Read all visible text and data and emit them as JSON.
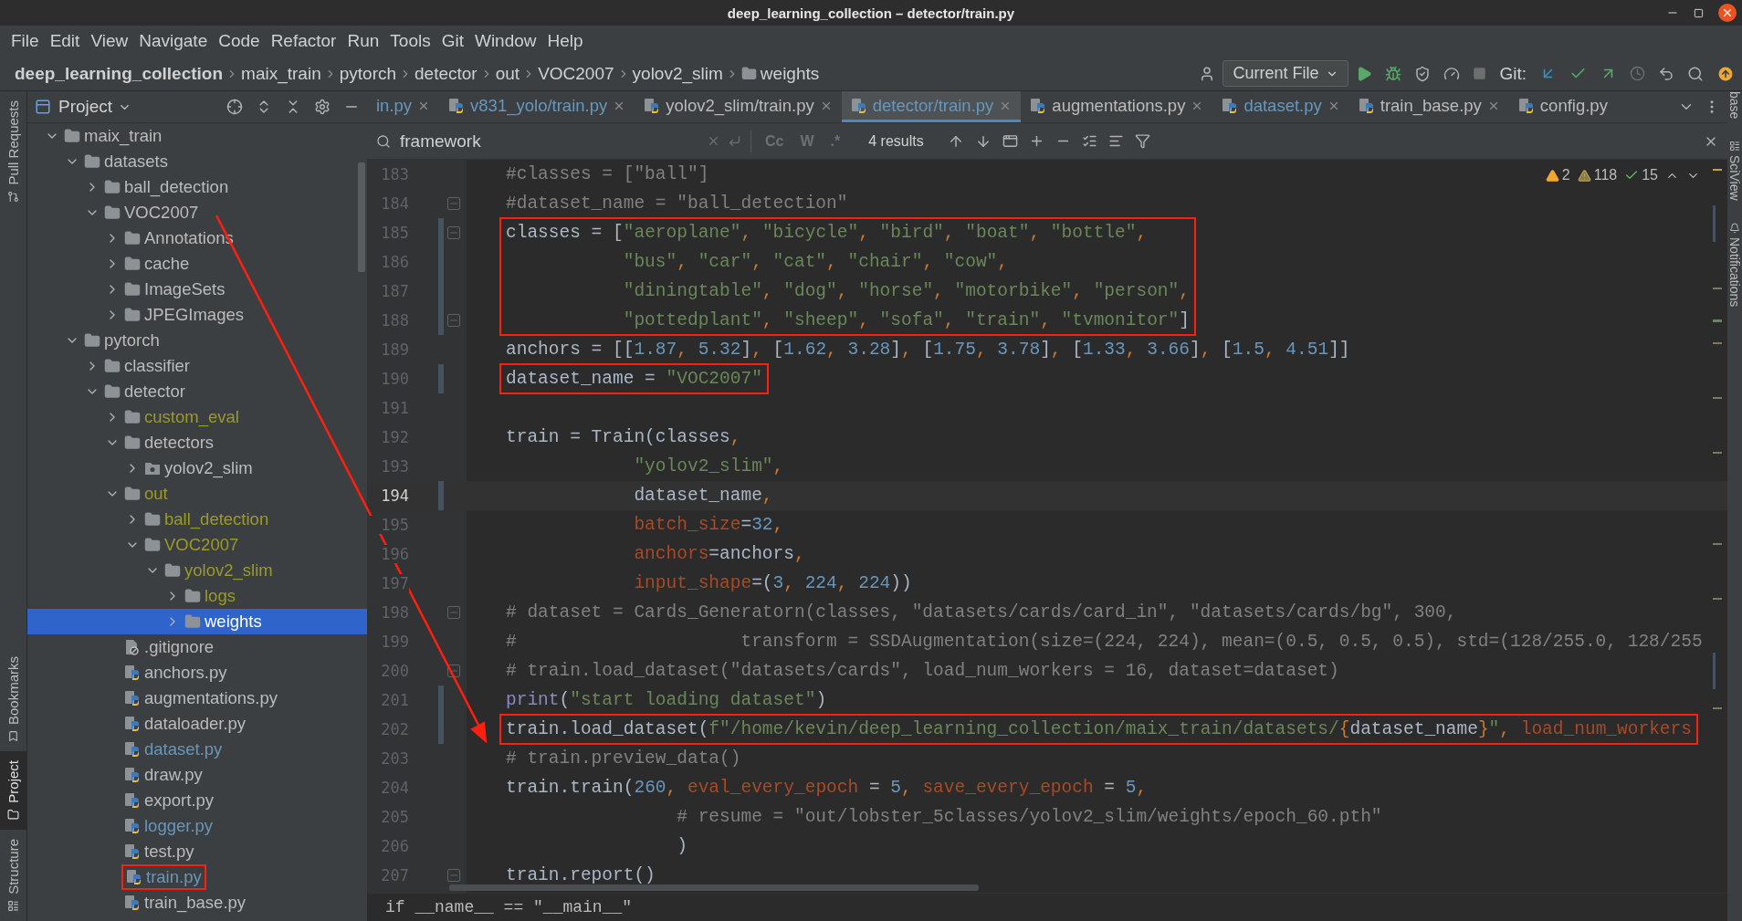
{
  "window": {
    "title": "deep_learning_collection – detector/train.py"
  },
  "menu": [
    "File",
    "Edit",
    "View",
    "Navigate",
    "Code",
    "Refactor",
    "Run",
    "Tools",
    "Git",
    "Window",
    "Help"
  ],
  "breadcrumb": [
    "deep_learning_collection",
    "maix_train",
    "pytorch",
    "detector",
    "out",
    "VOC2007",
    "yolov2_slim",
    "weights"
  ],
  "run_config": {
    "label": "Current File"
  },
  "git_label": "Git:",
  "left_strip": [
    {
      "label": "Pull Requests",
      "selected": false
    },
    {
      "label": "Bookmarks",
      "selected": false
    },
    {
      "label": "Project",
      "selected": true
    },
    {
      "label": "Structure",
      "selected": false
    }
  ],
  "right_strip": [
    {
      "label": "base"
    },
    {
      "label": "SciView"
    },
    {
      "label": "Notifications"
    }
  ],
  "project_panel": {
    "title": "Project",
    "tree": [
      {
        "name": "maix_train",
        "kind": "folder",
        "ignored": false,
        "selected": false,
        "boxed": false,
        "expanded": true,
        "children": [
          {
            "name": "datasets",
            "kind": "folder",
            "ignored": false,
            "selected": false,
            "boxed": false,
            "expanded": true,
            "children": [
              {
                "name": "ball_detection",
                "kind": "folder",
                "ignored": false,
                "selected": false,
                "boxed": false,
                "expanded": false
              },
              {
                "name": "VOC2007",
                "kind": "folder",
                "ignored": false,
                "selected": false,
                "boxed": false,
                "expanded": true,
                "children": [
                  {
                    "name": "Annotations",
                    "kind": "folder",
                    "ignored": false,
                    "selected": false,
                    "boxed": false,
                    "expanded": false
                  },
                  {
                    "name": "cache",
                    "kind": "folder",
                    "ignored": false,
                    "selected": false,
                    "boxed": false,
                    "expanded": false
                  },
                  {
                    "name": "ImageSets",
                    "kind": "folder",
                    "ignored": false,
                    "selected": false,
                    "boxed": false,
                    "expanded": false
                  },
                  {
                    "name": "JPEGImages",
                    "kind": "folder",
                    "ignored": false,
                    "selected": false,
                    "boxed": false,
                    "expanded": false
                  }
                ]
              }
            ]
          },
          {
            "name": "pytorch",
            "kind": "folder",
            "ignored": false,
            "selected": false,
            "boxed": false,
            "expanded": true,
            "children": [
              {
                "name": "classifier",
                "kind": "folder",
                "ignored": false,
                "selected": false,
                "boxed": false,
                "expanded": false
              },
              {
                "name": "detector",
                "kind": "folder",
                "ignored": false,
                "selected": false,
                "boxed": false,
                "expanded": true,
                "children": [
                  {
                    "name": "custom_eval",
                    "kind": "folder",
                    "ignored": true,
                    "selected": false,
                    "boxed": false,
                    "expanded": false
                  },
                  {
                    "name": "detectors",
                    "kind": "folder",
                    "ignored": false,
                    "selected": false,
                    "boxed": false,
                    "expanded": true,
                    "children": [
                      {
                        "name": "yolov2_slim",
                        "kind": "package",
                        "ignored": false,
                        "selected": false,
                        "boxed": false,
                        "expanded": false
                      }
                    ]
                  },
                  {
                    "name": "out",
                    "kind": "folder",
                    "ignored": true,
                    "selected": false,
                    "boxed": false,
                    "expanded": true,
                    "children": [
                      {
                        "name": "ball_detection",
                        "kind": "folder",
                        "ignored": true,
                        "selected": false,
                        "boxed": false,
                        "expanded": false
                      },
                      {
                        "name": "VOC2007",
                        "kind": "folder",
                        "ignored": true,
                        "selected": false,
                        "boxed": false,
                        "expanded": true,
                        "children": [
                          {
                            "name": "yolov2_slim",
                            "kind": "folder",
                            "ignored": true,
                            "selected": false,
                            "boxed": false,
                            "expanded": true,
                            "children": [
                              {
                                "name": "logs",
                                "kind": "folder",
                                "ignored": true,
                                "selected": false,
                                "boxed": false,
                                "expanded": false
                              },
                              {
                                "name": "weights",
                                "kind": "folder",
                                "ignored": true,
                                "selected": true,
                                "boxed": false,
                                "expanded": false
                              }
                            ]
                          }
                        ]
                      }
                    ]
                  },
                  {
                    "name": ".gitignore",
                    "kind": "gitignore",
                    "modified": false,
                    "selected": false,
                    "boxed": false
                  },
                  {
                    "name": "anchors.py",
                    "kind": "python",
                    "modified": false,
                    "selected": false,
                    "boxed": false
                  },
                  {
                    "name": "augmentations.py",
                    "kind": "python",
                    "modified": false,
                    "selected": false,
                    "boxed": false
                  },
                  {
                    "name": "dataloader.py",
                    "kind": "python",
                    "modified": false,
                    "selected": false,
                    "boxed": false
                  },
                  {
                    "name": "dataset.py",
                    "kind": "python",
                    "modified": true,
                    "selected": false,
                    "boxed": false
                  },
                  {
                    "name": "draw.py",
                    "kind": "python",
                    "modified": false,
                    "selected": false,
                    "boxed": false
                  },
                  {
                    "name": "export.py",
                    "kind": "python",
                    "modified": false,
                    "selected": false,
                    "boxed": false
                  },
                  {
                    "name": "logger.py",
                    "kind": "python",
                    "modified": true,
                    "selected": false,
                    "boxed": false
                  },
                  {
                    "name": "test.py",
                    "kind": "python",
                    "modified": false,
                    "selected": false,
                    "boxed": false
                  },
                  {
                    "name": "train.py",
                    "kind": "python",
                    "modified": true,
                    "selected": false,
                    "boxed": true
                  },
                  {
                    "name": "train_base.py",
                    "kind": "python",
                    "modified": false,
                    "selected": false,
                    "boxed": false
                  }
                ]
              }
            ]
          }
        ]
      }
    ]
  },
  "tabs": [
    {
      "label": "in.py",
      "selected": false,
      "modified": true,
      "icon": false,
      "closable": true
    },
    {
      "label": "v831_yolo/train.py",
      "selected": false,
      "modified": true,
      "icon": true,
      "closable": true
    },
    {
      "label": "yolov2_slim/train.py",
      "selected": false,
      "modified": false,
      "icon": true,
      "closable": true
    },
    {
      "label": "detector/train.py",
      "selected": true,
      "modified": true,
      "icon": true,
      "closable": true
    },
    {
      "label": "augmentations.py",
      "selected": false,
      "modified": false,
      "icon": true,
      "closable": true
    },
    {
      "label": "dataset.py",
      "selected": false,
      "modified": true,
      "icon": true,
      "closable": true
    },
    {
      "label": "train_base.py",
      "selected": false,
      "modified": false,
      "icon": true,
      "closable": true
    },
    {
      "label": "config.py",
      "selected": false,
      "modified": false,
      "icon": true,
      "closable": false
    }
  ],
  "find_bar": {
    "value": "framework",
    "options": [
      "Cc",
      "W",
      ".*"
    ],
    "results": "4 results"
  },
  "inspections": [
    {
      "kind": "warning",
      "count": "2"
    },
    {
      "kind": "weak_warning",
      "count": "118"
    },
    {
      "kind": "typo",
      "count": "15"
    }
  ],
  "code": [
    {
      "number": "183",
      "changed": false,
      "fold": false,
      "current": false,
      "boxed": false,
      "tokens": [
        {
          "kind": "comment",
          "text": "#classes = [\"ball\"]"
        }
      ]
    },
    {
      "number": "184",
      "changed": false,
      "fold": true,
      "current": false,
      "boxed": false,
      "tokens": [
        {
          "kind": "comment",
          "text": "#dataset_name = \"ball_detection\""
        }
      ]
    },
    {
      "number": "185",
      "changed": true,
      "fold": true,
      "current": false,
      "boxed": true,
      "tokens": [
        {
          "kind": "plain",
          "text": "classes = ["
        },
        {
          "kind": "string",
          "text": "\"aeroplane\""
        },
        {
          "kind": "punct",
          "text": ", "
        },
        {
          "kind": "string",
          "text": "\"bicycle\""
        },
        {
          "kind": "punct",
          "text": ", "
        },
        {
          "kind": "string",
          "text": "\"bird\""
        },
        {
          "kind": "punct",
          "text": ", "
        },
        {
          "kind": "string",
          "text": "\"boat\""
        },
        {
          "kind": "punct",
          "text": ", "
        },
        {
          "kind": "string",
          "text": "\"bottle\""
        },
        {
          "kind": "punct",
          "text": ","
        }
      ]
    },
    {
      "number": "186",
      "changed": true,
      "fold": false,
      "current": false,
      "boxed": true,
      "tokens": [
        {
          "kind": "string",
          "text": "           \"bus\""
        },
        {
          "kind": "punct",
          "text": ", "
        },
        {
          "kind": "string",
          "text": "\"car\""
        },
        {
          "kind": "punct",
          "text": ", "
        },
        {
          "kind": "string",
          "text": "\"cat\""
        },
        {
          "kind": "punct",
          "text": ", "
        },
        {
          "kind": "string",
          "text": "\"chair\""
        },
        {
          "kind": "punct",
          "text": ", "
        },
        {
          "kind": "string",
          "text": "\"cow\""
        },
        {
          "kind": "punct",
          "text": ","
        }
      ]
    },
    {
      "number": "187",
      "changed": true,
      "fold": false,
      "current": false,
      "boxed": true,
      "tokens": [
        {
          "kind": "string",
          "text": "           \"diningtable\""
        },
        {
          "kind": "punct",
          "text": ", "
        },
        {
          "kind": "string",
          "text": "\"dog\""
        },
        {
          "kind": "punct",
          "text": ", "
        },
        {
          "kind": "string",
          "text": "\"horse\""
        },
        {
          "kind": "punct",
          "text": ", "
        },
        {
          "kind": "string",
          "text": "\"motorbike\""
        },
        {
          "kind": "punct",
          "text": ", "
        },
        {
          "kind": "string",
          "text": "\"person\""
        },
        {
          "kind": "punct",
          "text": ","
        }
      ]
    },
    {
      "number": "188",
      "changed": true,
      "fold": true,
      "current": false,
      "boxed": true,
      "tokens": [
        {
          "kind": "string",
          "text": "           \"pottedplant\""
        },
        {
          "kind": "punct",
          "text": ", "
        },
        {
          "kind": "string",
          "text": "\"sheep\""
        },
        {
          "kind": "punct",
          "text": ", "
        },
        {
          "kind": "string",
          "text": "\"sofa\""
        },
        {
          "kind": "punct",
          "text": ", "
        },
        {
          "kind": "string",
          "text": "\"train\""
        },
        {
          "kind": "punct",
          "text": ", "
        },
        {
          "kind": "string",
          "text": "\"tvmonitor\""
        },
        {
          "kind": "plain",
          "text": "]"
        }
      ]
    },
    {
      "number": "189",
      "changed": false,
      "fold": false,
      "current": false,
      "boxed": false,
      "tokens": [
        {
          "kind": "plain",
          "text": "anchors = [["
        },
        {
          "kind": "number",
          "text": "1.87"
        },
        {
          "kind": "punct",
          "text": ", "
        },
        {
          "kind": "number",
          "text": "5.32"
        },
        {
          "kind": "plain",
          "text": "]"
        },
        {
          "kind": "punct",
          "text": ", "
        },
        {
          "kind": "plain",
          "text": "["
        },
        {
          "kind": "number",
          "text": "1.62"
        },
        {
          "kind": "punct",
          "text": ", "
        },
        {
          "kind": "number",
          "text": "3.28"
        },
        {
          "kind": "plain",
          "text": "]"
        },
        {
          "kind": "punct",
          "text": ", "
        },
        {
          "kind": "plain",
          "text": "["
        },
        {
          "kind": "number",
          "text": "1.75"
        },
        {
          "kind": "punct",
          "text": ", "
        },
        {
          "kind": "number",
          "text": "3.78"
        },
        {
          "kind": "plain",
          "text": "]"
        },
        {
          "kind": "punct",
          "text": ", "
        },
        {
          "kind": "plain",
          "text": "["
        },
        {
          "kind": "number",
          "text": "1.33"
        },
        {
          "kind": "punct",
          "text": ", "
        },
        {
          "kind": "number",
          "text": "3.66"
        },
        {
          "kind": "plain",
          "text": "]"
        },
        {
          "kind": "punct",
          "text": ", "
        },
        {
          "kind": "plain",
          "text": "["
        },
        {
          "kind": "number",
          "text": "1.5"
        },
        {
          "kind": "punct",
          "text": ", "
        },
        {
          "kind": "number",
          "text": "4.51"
        },
        {
          "kind": "plain",
          "text": "]]"
        }
      ]
    },
    {
      "number": "190",
      "changed": true,
      "fold": false,
      "current": false,
      "boxed": true,
      "tokens": [
        {
          "kind": "plain",
          "text": "dataset_name = "
        },
        {
          "kind": "string",
          "text": "\"VOC2007\""
        }
      ]
    },
    {
      "number": "191",
      "changed": false,
      "fold": false,
      "current": false,
      "boxed": false
    },
    {
      "number": "192",
      "changed": false,
      "fold": false,
      "current": false,
      "boxed": false,
      "tokens": [
        {
          "kind": "plain",
          "text": "train = Train(classes"
        },
        {
          "kind": "punct",
          "text": ","
        }
      ]
    },
    {
      "number": "193",
      "changed": false,
      "fold": false,
      "current": false,
      "boxed": false,
      "tokens": [
        {
          "kind": "string",
          "text": "            \"yolov2_slim\""
        },
        {
          "kind": "punct",
          "text": ","
        }
      ]
    },
    {
      "number": "194",
      "changed": true,
      "fold": false,
      "current": true,
      "boxed": false,
      "tokens": [
        {
          "kind": "plain",
          "text": "            dataset_name"
        },
        {
          "kind": "punct",
          "text": ","
        }
      ]
    },
    {
      "number": "195",
      "changed": false,
      "fold": false,
      "current": false,
      "boxed": false,
      "tokens": [
        {
          "kind": "param",
          "text": "            batch_size"
        },
        {
          "kind": "plain",
          "text": "="
        },
        {
          "kind": "number",
          "text": "32"
        },
        {
          "kind": "punct",
          "text": ","
        }
      ]
    },
    {
      "number": "196",
      "changed": false,
      "fold": false,
      "current": false,
      "boxed": false,
      "tokens": [
        {
          "kind": "param",
          "text": "            anchors"
        },
        {
          "kind": "plain",
          "text": "=anchors"
        },
        {
          "kind": "punct",
          "text": ","
        }
      ]
    },
    {
      "number": "197",
      "changed": false,
      "fold": false,
      "current": false,
      "boxed": false,
      "tokens": [
        {
          "kind": "param",
          "text": "            input_shape"
        },
        {
          "kind": "plain",
          "text": "=("
        },
        {
          "kind": "number",
          "text": "3"
        },
        {
          "kind": "punct",
          "text": ", "
        },
        {
          "kind": "number",
          "text": "224"
        },
        {
          "kind": "punct",
          "text": ", "
        },
        {
          "kind": "number",
          "text": "224"
        },
        {
          "kind": "plain",
          "text": "))"
        }
      ]
    },
    {
      "number": "198",
      "changed": false,
      "fold": true,
      "current": false,
      "boxed": false,
      "tokens": [
        {
          "kind": "comment",
          "text": "# dataset = Cards_Generatorn(classes, \"datasets/cards/card_in\", \"datasets/cards/bg\", 300,"
        }
      ]
    },
    {
      "number": "199",
      "changed": false,
      "fold": false,
      "current": false,
      "boxed": false,
      "tokens": [
        {
          "kind": "comment",
          "text": "#                     transform = SSDAugmentation(size=(224, 224), mean=(0.5, 0.5, 0.5), std=(128/255.0, 128/255"
        }
      ]
    },
    {
      "number": "200",
      "changed": false,
      "fold": true,
      "current": false,
      "boxed": false,
      "tokens": [
        {
          "kind": "comment",
          "text": "# train.load_dataset(\"datasets/cards\", load_num_workers = 16, dataset=dataset)"
        }
      ]
    },
    {
      "number": "201",
      "changed": true,
      "fold": false,
      "current": false,
      "boxed": false,
      "tokens": [
        {
          "kind": "builtin",
          "text": "print"
        },
        {
          "kind": "plain",
          "text": "("
        },
        {
          "kind": "string",
          "text": "\"start loading dataset\""
        },
        {
          "kind": "plain",
          "text": ")"
        }
      ]
    },
    {
      "number": "202",
      "changed": true,
      "fold": false,
      "current": false,
      "boxed": true,
      "tokens": [
        {
          "kind": "plain",
          "text": "train.load_dataset("
        },
        {
          "kind": "string",
          "text": "f\"/home/kevin/deep_learning_collection/maix_train/datasets/"
        },
        {
          "kind": "punct",
          "text": "{"
        },
        {
          "kind": "plain",
          "text": "dataset_name"
        },
        {
          "kind": "punct",
          "text": "}"
        },
        {
          "kind": "string",
          "text": "\""
        },
        {
          "kind": "punct",
          "text": ", "
        },
        {
          "kind": "param",
          "text": "load_num_workers"
        }
      ]
    },
    {
      "number": "203",
      "changed": false,
      "fold": false,
      "current": false,
      "boxed": false,
      "tokens": [
        {
          "kind": "comment",
          "text": "# train.preview_data()"
        }
      ]
    },
    {
      "number": "204",
      "changed": false,
      "fold": false,
      "current": false,
      "boxed": false,
      "tokens": [
        {
          "kind": "plain",
          "text": "train.train("
        },
        {
          "kind": "number",
          "text": "260"
        },
        {
          "kind": "punct",
          "text": ", "
        },
        {
          "kind": "param",
          "text": "eval_every_epoch"
        },
        {
          "kind": "plain",
          "text": " = "
        },
        {
          "kind": "number",
          "text": "5"
        },
        {
          "kind": "punct",
          "text": ", "
        },
        {
          "kind": "param",
          "text": "save_every_epoch"
        },
        {
          "kind": "plain",
          "text": " = "
        },
        {
          "kind": "number",
          "text": "5"
        },
        {
          "kind": "punct",
          "text": ","
        }
      ]
    },
    {
      "number": "205",
      "changed": false,
      "fold": false,
      "current": false,
      "boxed": false,
      "tokens": [
        {
          "kind": "comment",
          "text": "                # resume = \"out/lobster_5classes/yolov2_slim/weights/epoch_60.pth\""
        }
      ]
    },
    {
      "number": "206",
      "changed": false,
      "fold": false,
      "current": false,
      "boxed": false,
      "tokens": [
        {
          "kind": "plain",
          "text": "                )"
        }
      ]
    },
    {
      "number": "207",
      "changed": false,
      "fold": true,
      "current": false,
      "boxed": false,
      "tokens": [
        {
          "kind": "plain",
          "text": "train.report()"
        }
      ]
    }
  ],
  "code_breadcrumb": "if __name__ == \"__main__\""
}
